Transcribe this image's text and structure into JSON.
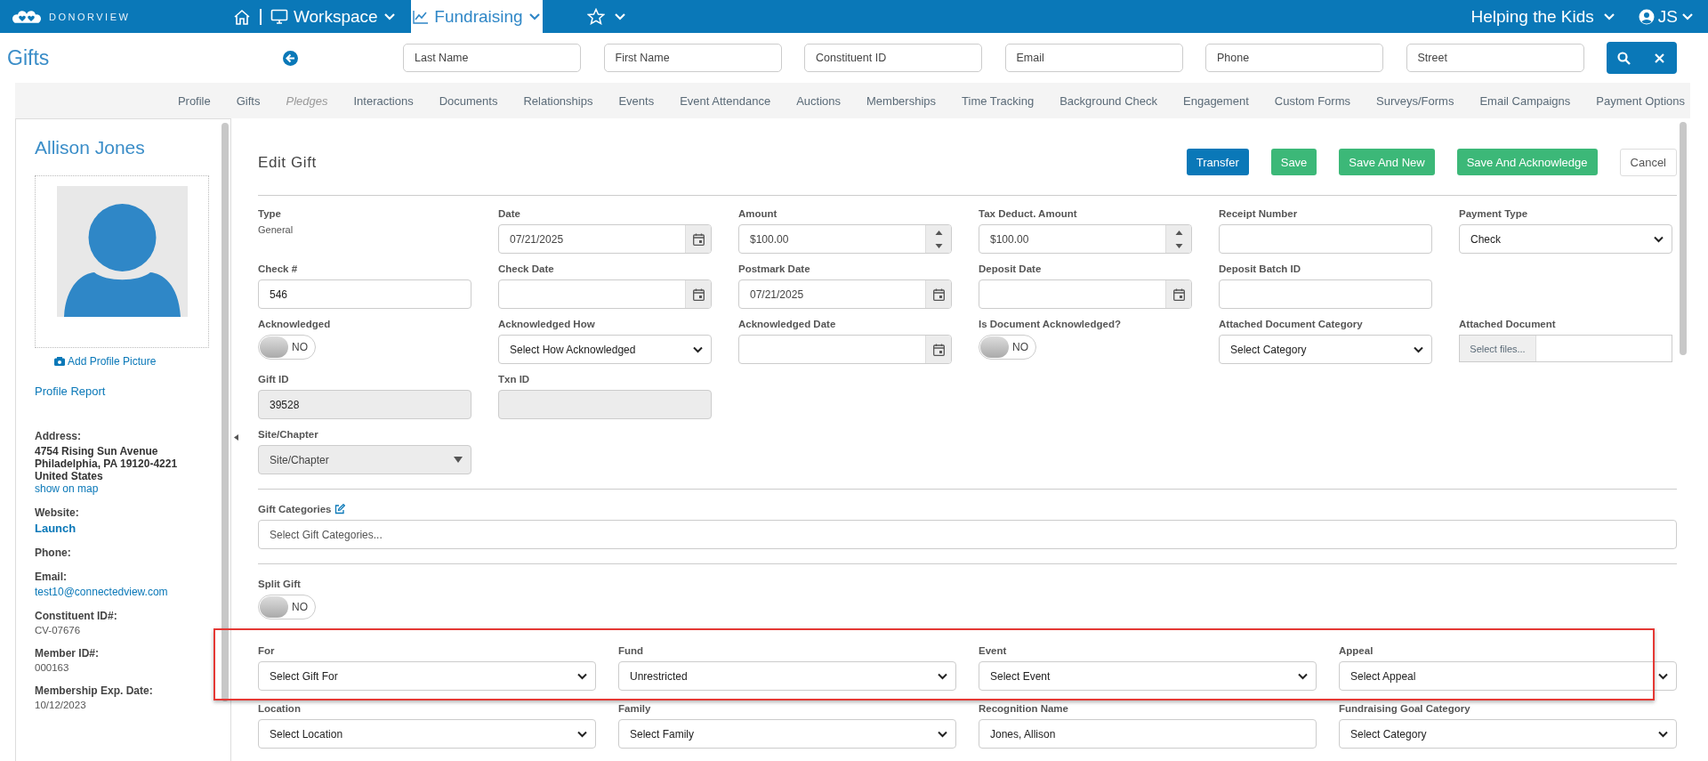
{
  "brand": "DONORVIEW",
  "nav_tabs": [
    {
      "kind": "workspace",
      "label": "Workspace",
      "selected": false
    },
    {
      "kind": "fundraising",
      "label": "Fundraising",
      "selected": true
    },
    {
      "kind": "favorites",
      "selected": false
    }
  ],
  "organization": "Helping the Kids",
  "user": "JS",
  "page_title": "Gifts",
  "search_fields": [
    {
      "placeholder": "Last Name"
    },
    {
      "placeholder": "First Name"
    },
    {
      "placeholder": "Constituent ID"
    },
    {
      "placeholder": "Email"
    },
    {
      "placeholder": "Phone"
    },
    {
      "placeholder": "Street"
    }
  ],
  "record_tabs": [
    {
      "label": "Profile",
      "disabled": false
    },
    {
      "label": "Gifts",
      "disabled": false
    },
    {
      "label": "Pledges",
      "disabled": true
    },
    {
      "label": "Interactions",
      "disabled": false
    },
    {
      "label": "Documents",
      "disabled": false
    },
    {
      "label": "Relationships",
      "disabled": false
    },
    {
      "label": "Events",
      "disabled": false
    },
    {
      "label": "Event Attendance",
      "disabled": false
    },
    {
      "label": "Auctions",
      "disabled": false
    },
    {
      "label": "Memberships",
      "disabled": false
    },
    {
      "label": "Time Tracking",
      "disabled": false
    },
    {
      "label": "Background Check",
      "disabled": false
    },
    {
      "label": "Engagement",
      "disabled": false
    },
    {
      "label": "Custom Forms",
      "disabled": false
    },
    {
      "label": "Surveys/Forms",
      "disabled": false
    },
    {
      "label": "Email Campaigns",
      "disabled": false
    },
    {
      "label": "Payment Options",
      "disabled": false
    }
  ],
  "profile": {
    "name": "Allison Jones",
    "add_picture": "Add Profile Picture",
    "report_link": "Profile Report",
    "details": [
      {
        "label": "Address:",
        "values": [
          {
            "kind": "bold",
            "text": "4754 Rising Sun Avenue"
          },
          {
            "kind": "bold",
            "text": "Philadelphia, PA 19120-4221"
          },
          {
            "kind": "bold",
            "text": "United States"
          },
          {
            "kind": "link",
            "text": "show on map"
          }
        ]
      },
      {
        "label": "Website:",
        "values": [
          {
            "kind": "strong_link",
            "text": "Launch"
          }
        ]
      },
      {
        "label": "Phone:"
      },
      {
        "label": "Email:",
        "values": [
          {
            "kind": "link",
            "text": "test10@connectedview.com"
          }
        ]
      },
      {
        "label": "Constituent ID#:",
        "values": [
          {
            "kind": "plain",
            "text": "CV-07676"
          }
        ]
      },
      {
        "label": "Member ID#:",
        "values": [
          {
            "kind": "plain",
            "text": "000163"
          }
        ]
      },
      {
        "label": "Membership Exp. Date:",
        "values": [
          {
            "kind": "plain",
            "text": "10/12/2023"
          }
        ]
      }
    ]
  },
  "form": {
    "title": "Edit Gift",
    "buttons": [
      {
        "label": "Transfer",
        "kind": "primary"
      },
      {
        "label": "Save",
        "kind": "success"
      },
      {
        "label": "Save And New",
        "kind": "success"
      },
      {
        "label": "Save And Acknowledge",
        "kind": "success"
      },
      {
        "label": "Cancel",
        "kind": "default"
      }
    ],
    "rows": [
      [
        {
          "label": "Type",
          "kind": "static",
          "value": "General"
        },
        {
          "label": "Date",
          "kind": "date",
          "value": "07/21/2025"
        },
        {
          "label": "Amount",
          "kind": "number",
          "value": "$100.00"
        },
        {
          "label": "Tax Deduct. Amount",
          "kind": "number",
          "value": "$100.00"
        },
        {
          "label": "Receipt Number",
          "kind": "text"
        },
        {
          "label": "Payment Type",
          "kind": "select",
          "value": "Check"
        }
      ],
      [
        {
          "label": "Check #",
          "kind": "text",
          "value": "546"
        },
        {
          "label": "Check Date",
          "kind": "date"
        },
        {
          "label": "Postmark Date",
          "kind": "date",
          "value": "07/21/2025"
        },
        {
          "label": "Deposit Date",
          "kind": "date"
        },
        {
          "label": "Deposit Batch ID",
          "kind": "text"
        }
      ],
      [
        {
          "label": "Acknowledged",
          "kind": "toggle",
          "on": false,
          "state_label": "NO"
        },
        {
          "label": "Acknowledged How",
          "kind": "select",
          "value": "Select How Acknowledged"
        },
        {
          "label": "Acknowledged Date",
          "kind": "date"
        },
        {
          "label": "Is Document Acknowledged?",
          "kind": "toggle",
          "on": false,
          "state_label": "NO"
        },
        {
          "label": "Attached Document Category",
          "kind": "select",
          "value": "Select Category"
        },
        {
          "label": "Attached Document",
          "kind": "file",
          "button": "Select files..."
        }
      ],
      [
        {
          "label": "Gift ID",
          "kind": "readonly",
          "value": "39528"
        },
        {
          "label": "Txn ID",
          "kind": "readonly"
        }
      ],
      [
        {
          "label": "Site/Chapter",
          "kind": "readonly_select",
          "value": "Site/Chapter"
        }
      ]
    ],
    "gift_categories": {
      "label": "Gift Categories",
      "placeholder": "Select Gift Categories..."
    },
    "split_gift": {
      "label": "Split Gift",
      "on": false,
      "state_label": "NO"
    },
    "allocation_rows": [
      [
        {
          "label": "For",
          "kind": "select",
          "value": "Select Gift For"
        },
        {
          "label": "Fund",
          "kind": "select",
          "value": "Unrestricted"
        },
        {
          "label": "Event",
          "kind": "select",
          "value": "Select Event"
        },
        {
          "label": "Appeal",
          "kind": "select",
          "value": "Select Appeal"
        }
      ],
      [
        {
          "label": "Location",
          "kind": "select",
          "value": "Select Location"
        },
        {
          "label": "Family",
          "kind": "select",
          "value": "Select Family"
        },
        {
          "label": "Recognition Name",
          "kind": "text",
          "value": "Jones, Allison"
        },
        {
          "label": "Fundraising Goal Category",
          "kind": "select",
          "value": "Select Category"
        }
      ]
    ]
  }
}
